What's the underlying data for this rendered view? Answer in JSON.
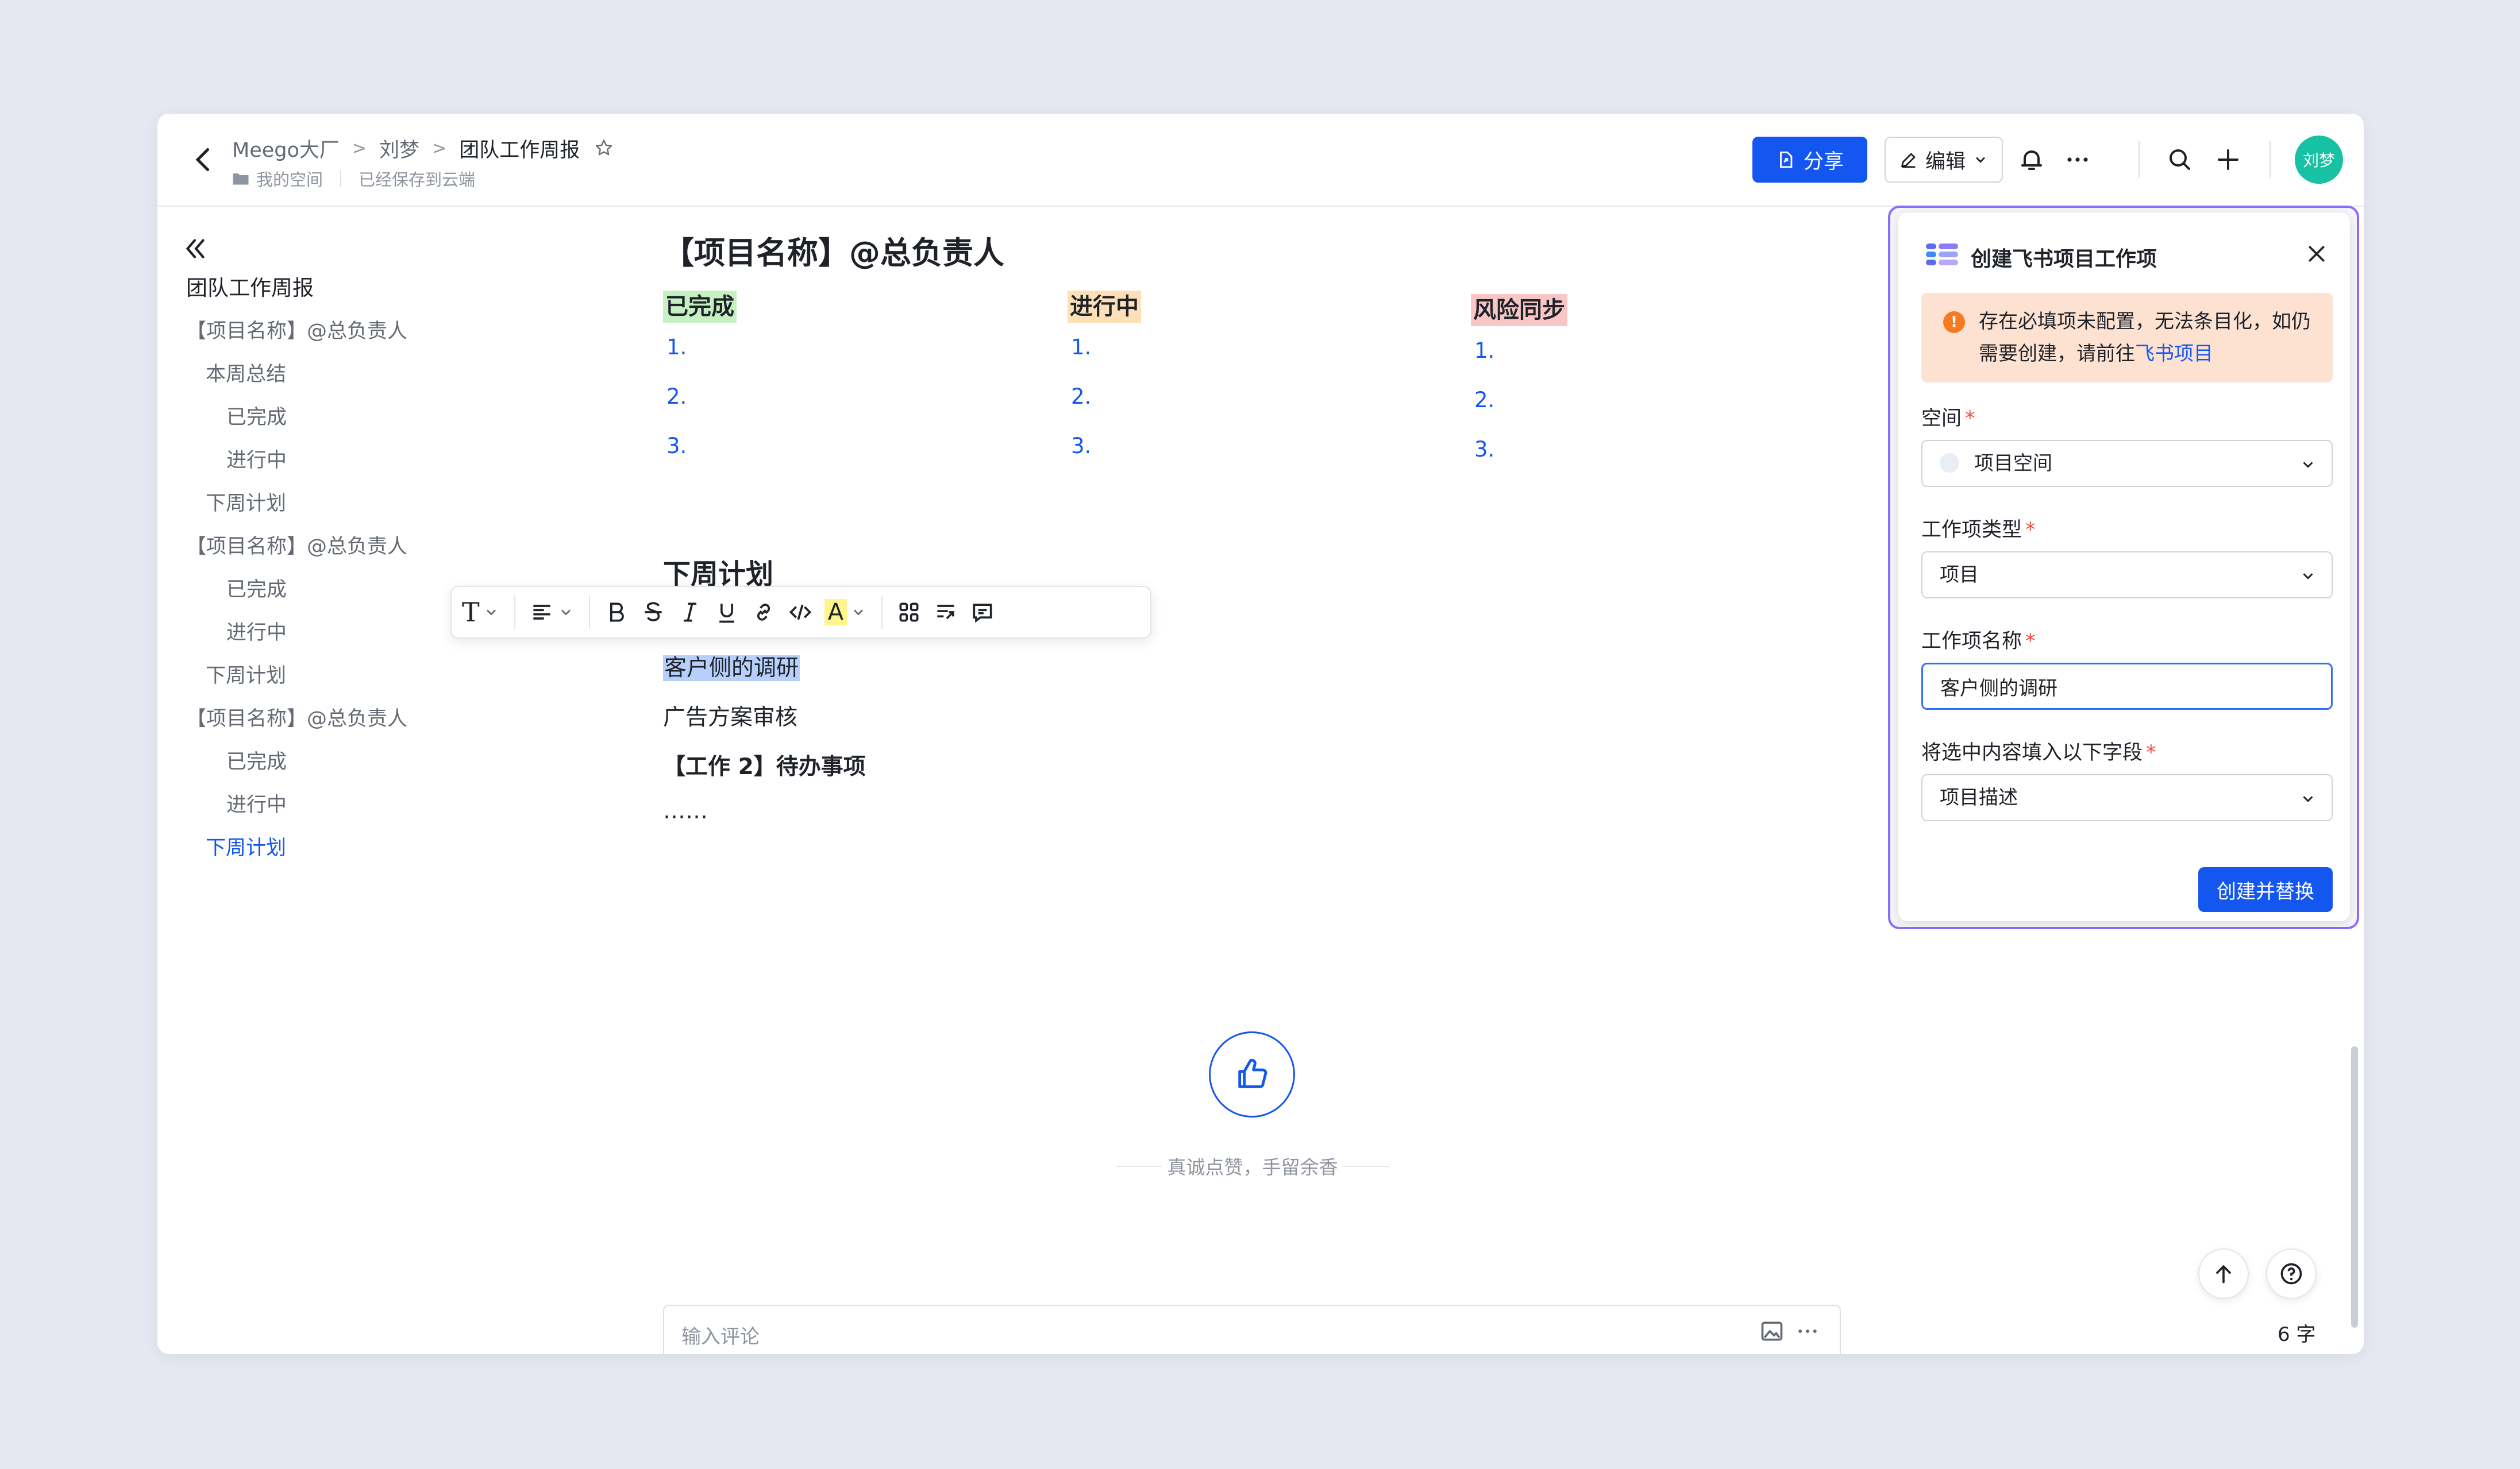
{
  "header": {
    "breadcrumb": [
      "Meego大厂",
      "刘梦",
      "团队工作周报"
    ],
    "breadcrumb_sep": ">",
    "location": "我的空间",
    "save_status": "已经保存到云端",
    "share_label": "分享",
    "edit_label": "编辑",
    "avatar_text": "刘梦",
    "avatar_color": "#16c2a3"
  },
  "outline": {
    "items": [
      {
        "label": "团队工作周报"
      },
      {
        "label": "【项目名称】@总负责人"
      },
      {
        "label": "本周总结"
      },
      {
        "label": "已完成"
      },
      {
        "label": "进行中"
      },
      {
        "label": "下周计划"
      },
      {
        "label": "【项目名称】@总负责人"
      },
      {
        "label": "已完成"
      },
      {
        "label": "进行中"
      },
      {
        "label": "下周计划"
      },
      {
        "label": "【项目名称】@总负责人"
      },
      {
        "label": "已完成"
      },
      {
        "label": "进行中"
      },
      {
        "label": "下周计划"
      }
    ]
  },
  "doc": {
    "heading": "【项目名称】@总负责人",
    "columns": [
      {
        "tag": "已完成",
        "tag_color": "#c6f0c2",
        "items": [
          "1.",
          "2.",
          "3."
        ]
      },
      {
        "tag": "进行中",
        "tag_color": "#fde0b8",
        "items": [
          "1.",
          "2.",
          "3."
        ]
      },
      {
        "tag": "风险同步",
        "tag_color": "#f9c6c6",
        "items": [
          "1.",
          "2.",
          "3."
        ]
      }
    ],
    "next_heading": "下周计划",
    "selected_line": "客户侧的调研",
    "line2": "广告方案审核",
    "line3": "【工作 2】待办事项",
    "line4": "……"
  },
  "toolbar": {
    "text_label": "T",
    "highlight_label": "A"
  },
  "like": {
    "text": "真诚点赞，手留余香",
    "accent": "#1456f0"
  },
  "comment": {
    "placeholder": "输入评论",
    "word_count": "6 字"
  },
  "panel": {
    "title": "创建飞书项目工作项",
    "alert_text": "存在必填项未配置，无法条目化，如仍需要创建，请前往",
    "alert_link": "飞书项目",
    "fields": {
      "space": {
        "label": "空间",
        "value": "项目空间"
      },
      "type": {
        "label": "工作项类型",
        "value": "项目"
      },
      "name": {
        "label": "工作项名称",
        "value": "客户侧的调研"
      },
      "target": {
        "label": "将选中内容填入以下字段",
        "value": "项目描述"
      }
    },
    "submit_label": "创建并替换",
    "required_mark": "*"
  }
}
